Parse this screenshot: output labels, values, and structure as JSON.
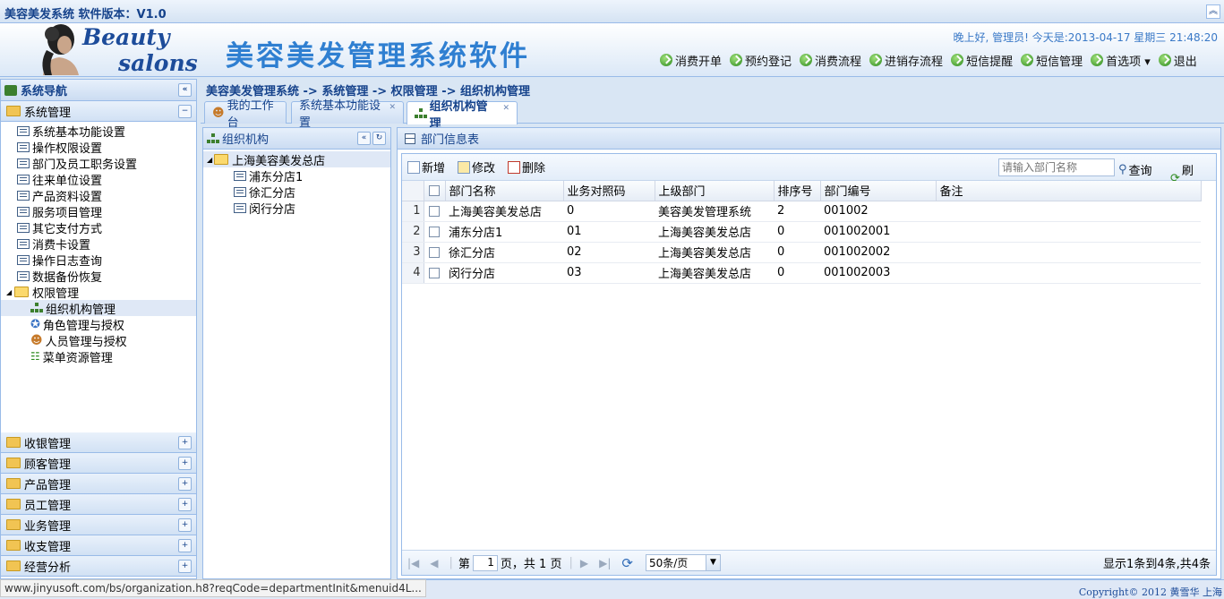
{
  "app": {
    "title": "美容美发系统 软件版本：V1.0"
  },
  "banner": {
    "logo_line1": "Beauty",
    "logo_line2": "salons",
    "title": "美容美发管理系统软件",
    "greeting": "晚上好, 管理员! 今天是:2013-04-17 星期三 21:48:20"
  },
  "topnav": [
    {
      "label": "消费开单",
      "icon": "refresh-icon"
    },
    {
      "label": "预约登记",
      "icon": "refresh-icon"
    },
    {
      "label": "消费流程",
      "icon": "refresh-icon"
    },
    {
      "label": "进销存流程",
      "icon": "refresh-icon"
    },
    {
      "label": "短信提醒",
      "icon": "refresh-icon"
    },
    {
      "label": "短信管理",
      "icon": "refresh-icon"
    },
    {
      "label": "首选项 ▾",
      "icon": "refresh-icon"
    },
    {
      "label": "退出",
      "icon": "refresh-icon"
    }
  ],
  "sidebar": {
    "title": "系统导航",
    "expanded_group": "系统管理",
    "system_items": [
      "系统基本功能设置",
      "操作权限设置",
      "部门及员工职务设置",
      "往来单位设置",
      "产品资料设置",
      "服务项目管理",
      "其它支付方式",
      "消费卡设置",
      "操作日志查询",
      "数据备份恢复"
    ],
    "perm_folder": "权限管理",
    "perm_items": [
      "组织机构管理",
      "角色管理与授权",
      "人员管理与授权",
      "菜单资源管理"
    ],
    "collapsed_groups": [
      "收银管理",
      "顾客管理",
      "产品管理",
      "员工管理",
      "业务管理",
      "收支管理",
      "经营分析"
    ]
  },
  "breadcrumb": "美容美发管理系统 -> 系统管理 -> 权限管理 -> 组织机构管理",
  "tabs": [
    "我的工作台",
    "系统基本功能设置",
    "组织机构管理"
  ],
  "org_panel": {
    "title": "组织机构",
    "root": "上海美容美发总店",
    "children": [
      "浦东分店1",
      "徐汇分店",
      "闵行分店"
    ]
  },
  "main_panel": {
    "title": "部门信息表",
    "buttons": {
      "add": "新增",
      "edit": "修改",
      "delete": "删除",
      "query": "查询",
      "refresh": "刷新"
    },
    "search_placeholder": "请输入部门名称",
    "columns": [
      "部门名称",
      "业务对照码",
      "上级部门",
      "排序号",
      "部门编号",
      "备注"
    ],
    "rows": [
      {
        "n": "1",
        "name": "上海美容美发总店",
        "code": "0",
        "parent": "美容美发管理系统",
        "sort": "2",
        "num": "001002",
        "note": ""
      },
      {
        "n": "2",
        "name": "浦东分店1",
        "code": "01",
        "parent": "上海美容美发总店",
        "sort": "0",
        "num": "001002001",
        "note": ""
      },
      {
        "n": "3",
        "name": "徐汇分店",
        "code": "02",
        "parent": "上海美容美发总店",
        "sort": "0",
        "num": "001002002",
        "note": ""
      },
      {
        "n": "4",
        "name": "闵行分店",
        "code": "03",
        "parent": "上海美容美发总店",
        "sort": "0",
        "num": "001002003",
        "note": ""
      }
    ],
    "pager": {
      "page_prefix": "第",
      "page": "1",
      "page_suffix": "页，共 1 页",
      "page_size": "50条/页",
      "summary": "显示1条到4条,共4条"
    }
  },
  "statusbar": {
    "url": "www.jinyusoft.com/bs/organization.h8?reqCode=departmentInit&menuid4L...",
    "copyright": "Copyright© 2012 黄雪华 上海"
  }
}
